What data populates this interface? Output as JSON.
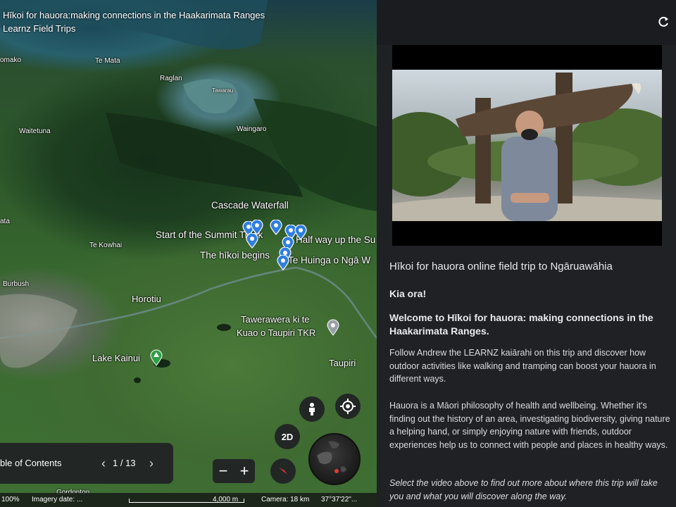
{
  "map": {
    "title": "Hīkoi for hauora:making connections in the Haakarimata Ranges",
    "subtitle": "Learnz Field Trips",
    "places": {
      "omako": "omako",
      "te_mata": "Te Mata",
      "raglan": "Raglan",
      "tawarau": "Tawarau",
      "waitetuna": "Waitetuna",
      "waingaro": "Waingaro",
      "cascade": "Cascade Waterfall",
      "start_summit": "Start of the Summit Track",
      "half_way": "Half way up the Su",
      "ata": "ata",
      "te_kowhai": "Te Kowhai",
      "hikoi_begins": "The hīkoi begins",
      "te_huinga": "Te Huinga o Ngā W",
      "burbush": "Burbush",
      "horotiu": "Horotiu",
      "tawerawera_1": "Tawerawera ki te",
      "tawerawera_2": "Kuao o Taupiri TKR",
      "lake_kainui": "Lake Kainui",
      "taupiri": "Taupiri",
      "gordonton": "Gordonton"
    },
    "toc": {
      "label": "ble of Contents",
      "page": "1 / 13",
      "prev_icon": "chevron-left-icon",
      "next_icon": "chevron-right-icon"
    },
    "controls": {
      "two_d": "2D",
      "zoom_out": "−",
      "zoom_in": "+"
    },
    "status": {
      "zoom": "100%",
      "imagery": "Imagery date: ...",
      "scale": "4,000 m",
      "camera": "Camera: 18 km",
      "coords": "37°37'22\"..."
    }
  },
  "panel": {
    "heading": "Hīkoi for hauora online field trip to Ngāruawāhia",
    "greeting": "Kia ora!",
    "welcome": "Welcome to Hīkoi for hauora: making connections in the Haakarimata Ranges.",
    "para1": "Follow Andrew the LEARNZ kaiārahi on this trip and discover how outdoor activities like walking and tramping can boost your hauora in different ways.",
    "para2": "Hauora is a Māori philosophy of health and wellbeing. Whether it's finding out the history of an area, investigating biodiversity, giving nature a helping hand, or simply enjoying nature with friends, outdoor experiences help us to connect with people and places in healthy ways.",
    "para3": "Select the video above to find out more about where this trip will take you and what you will discover along the way."
  },
  "colors": {
    "pin_blue": "#2f7de1",
    "panel_bg": "#202124",
    "tree_green": "#2ea043"
  }
}
